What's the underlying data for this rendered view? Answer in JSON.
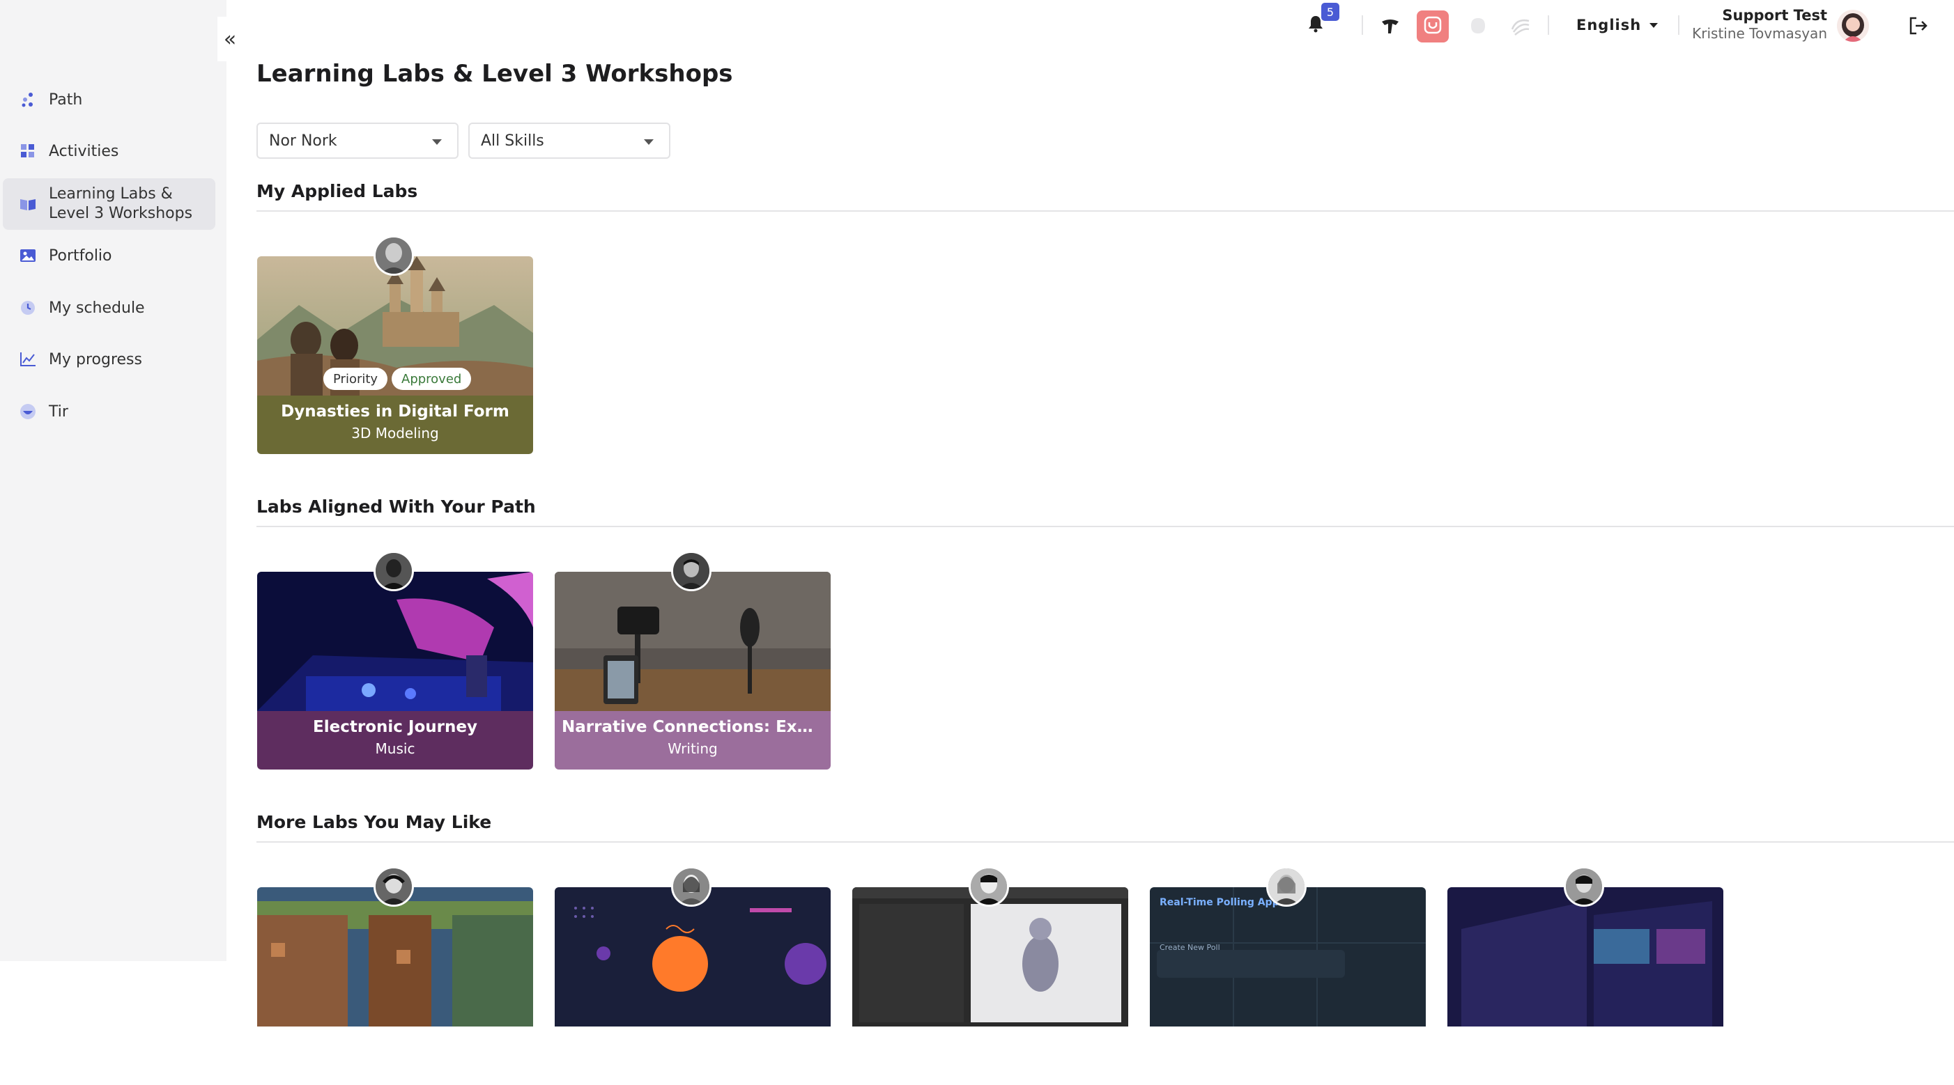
{
  "sidebar": {
    "items": [
      {
        "label": "Path",
        "icon": "path-dots-icon"
      },
      {
        "label": "Activities",
        "icon": "grid-icon"
      },
      {
        "label": "Learning Labs & Level 3 Workshops",
        "icon": "book-icon",
        "active": true
      },
      {
        "label": "Portfolio",
        "icon": "image-icon"
      },
      {
        "label": "My schedule",
        "icon": "clock-icon"
      },
      {
        "label": "My progress",
        "icon": "chart-line-icon"
      },
      {
        "label": "Tir",
        "icon": "bowl-icon"
      }
    ]
  },
  "header": {
    "notification_count": "5",
    "language": "English",
    "user_role": "Support Test",
    "user_name": "Kristine Tovmasyan"
  },
  "page": {
    "title": "Learning Labs & Level 3 Workshops",
    "filters": {
      "location": "Nor Nork",
      "skills": "All Skills"
    }
  },
  "sections": {
    "applied": {
      "title": "My Applied Labs",
      "cards": [
        {
          "title": "Dynasties in Digital Form",
          "subtitle": "3D Modeling",
          "badges": [
            "Priority",
            "Approved"
          ]
        }
      ]
    },
    "aligned": {
      "title": "Labs Aligned With Your Path",
      "cards": [
        {
          "title": "Electronic Journey",
          "subtitle": "Music"
        },
        {
          "title": "Narrative Connections: Explori...",
          "subtitle": "Writing"
        }
      ]
    },
    "more": {
      "title": "More Labs You May Like",
      "cards": [
        {
          "thumb_text": ""
        },
        {
          "thumb_text": ""
        },
        {
          "thumb_text": ""
        },
        {
          "thumb_text": "Real-Time Polling App",
          "thumb_sub": "Create New Poll"
        },
        {
          "thumb_text": ""
        }
      ]
    }
  },
  "colors": {
    "accent_blue": "#4a5bd4",
    "card_olive": "#6b6a35",
    "card_purple": "#5e2d5f",
    "card_mauve": "#9b6e9c",
    "pink_button": "#f08080"
  }
}
